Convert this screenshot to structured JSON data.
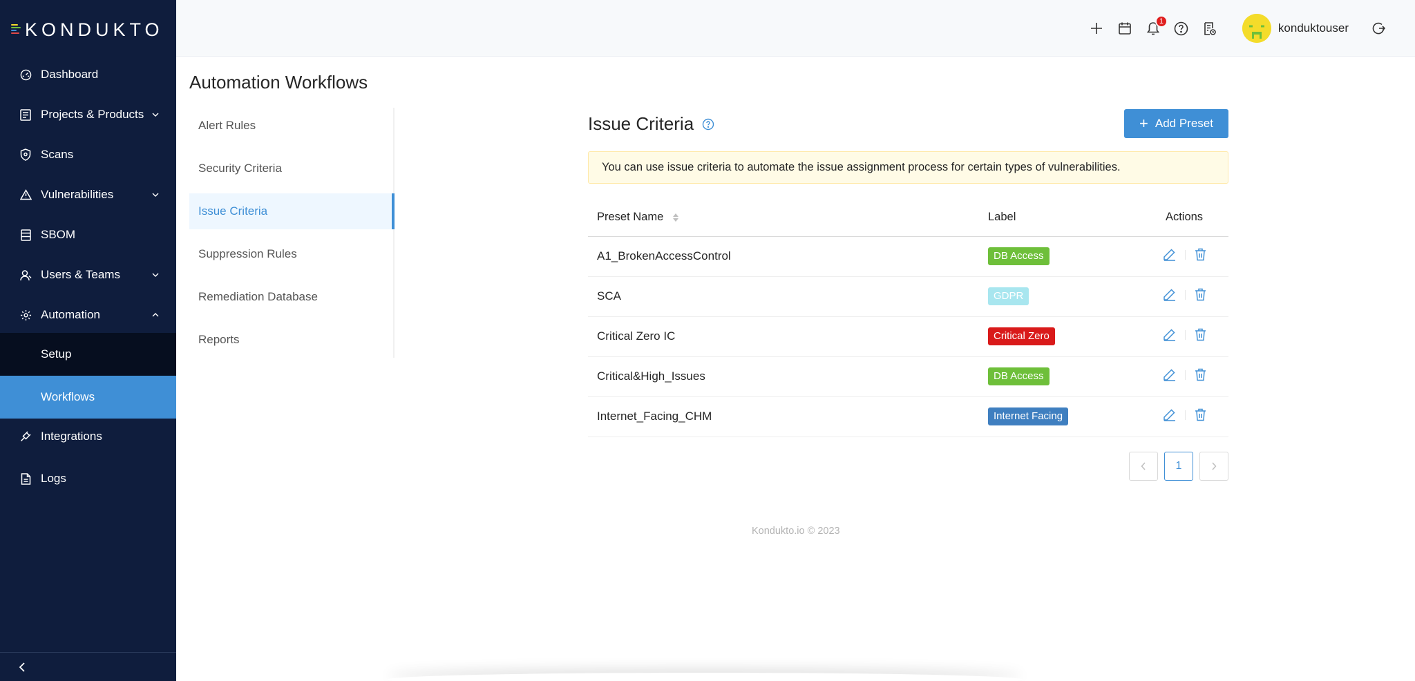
{
  "brand": {
    "name": "KONDUKTO",
    "logo_text_left": "KONDUK",
    "logo_text_mid": "T",
    "logo_text_right": "O"
  },
  "sidebar": {
    "items": [
      {
        "label": "Dashboard",
        "icon": "dashboard-icon"
      },
      {
        "label": "Projects & Products",
        "icon": "projects-icon",
        "expandable": true
      },
      {
        "label": "Scans",
        "icon": "shield-icon"
      },
      {
        "label": "Vulnerabilities",
        "icon": "warning-icon",
        "expandable": true
      },
      {
        "label": "SBOM",
        "icon": "sbom-icon"
      },
      {
        "label": "Users & Teams",
        "icon": "users-icon",
        "expandable": true
      },
      {
        "label": "Automation",
        "icon": "gear-icon",
        "expanded": true
      },
      {
        "label": "Integrations",
        "icon": "plug-icon"
      },
      {
        "label": "Logs",
        "icon": "file-icon"
      }
    ],
    "automation_sub": [
      {
        "label": "Setup"
      },
      {
        "label": "Workflows",
        "active": true
      }
    ]
  },
  "header": {
    "notification_count": "1",
    "username": "konduktouser"
  },
  "page": {
    "title": "Automation Workflows"
  },
  "subnav": [
    {
      "label": "Alert Rules"
    },
    {
      "label": "Security Criteria"
    },
    {
      "label": "Issue Criteria",
      "active": true
    },
    {
      "label": "Suppression Rules"
    },
    {
      "label": "Remediation Database"
    },
    {
      "label": "Reports"
    }
  ],
  "issue_criteria": {
    "title": "Issue Criteria",
    "add_button": "Add Preset",
    "notice": "You can use issue criteria to automate the issue assignment process for certain types of vulnerabilities.",
    "columns": {
      "name": "Preset Name",
      "label": "Label",
      "actions": "Actions"
    },
    "rows": [
      {
        "name": "A1_BrokenAccessControl",
        "label": "DB Access",
        "label_color": "#6ebf3a"
      },
      {
        "name": "SCA",
        "label": "GDPR",
        "label_color": "#a8e6ef"
      },
      {
        "name": "Critical Zero IC",
        "label": "Critical Zero",
        "label_color": "#d91a1a"
      },
      {
        "name": "Critical&High_Issues",
        "label": "DB Access",
        "label_color": "#6ebf3a"
      },
      {
        "name": "Internet_Facing_CHM",
        "label": "Internet Facing",
        "label_color": "#3f7fc0"
      }
    ],
    "pagination": {
      "current_page": "1"
    }
  },
  "footer": {
    "text": "Kondukto.io © 2023"
  },
  "colors": {
    "sidebar_bg": "#0f1d3d",
    "accent": "#3f8fd6",
    "notice_bg": "#fffbe6"
  }
}
